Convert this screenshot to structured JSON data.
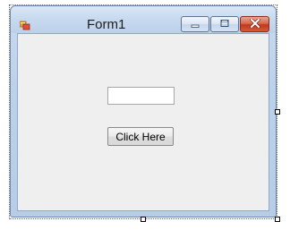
{
  "window": {
    "title": "Form1",
    "icon": "form-app-icon"
  },
  "caption_buttons": {
    "minimize_icon": "minimize-icon",
    "maximize_icon": "maximize-icon",
    "close_icon": "close-icon"
  },
  "form": {
    "textbox": {
      "value": "",
      "placeholder": ""
    },
    "button_label": "Click Here"
  },
  "colors": {
    "close_button": "#c0381c",
    "client_background": "#efefef",
    "frame": "#bcd1ea"
  }
}
